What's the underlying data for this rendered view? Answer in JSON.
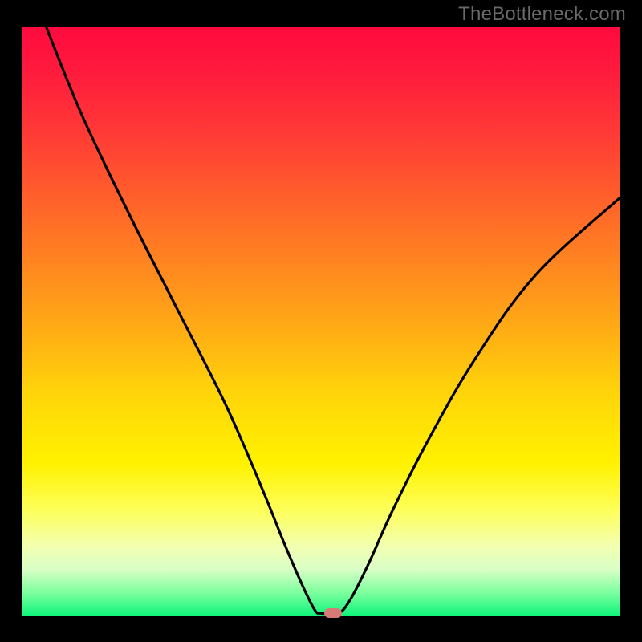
{
  "watermark": "TheBottleneck.com",
  "colors": {
    "page_bg": "#000000",
    "curve_stroke": "#000000",
    "marker_fill": "#d87b76",
    "watermark_text": "#6a6a6a",
    "gradient_top": "#ff0a3e",
    "gradient_mid": "#ffd40a",
    "gradient_bottom": "#0cf47a"
  },
  "chart_data": {
    "type": "line",
    "title": "",
    "xlabel": "",
    "ylabel": "",
    "xlim": [
      0,
      100
    ],
    "ylim": [
      0,
      100
    ],
    "grid": false,
    "legend": false,
    "curve_points": [
      {
        "x": 4,
        "y": 100
      },
      {
        "x": 10,
        "y": 85
      },
      {
        "x": 18,
        "y": 68
      },
      {
        "x": 26,
        "y": 52
      },
      {
        "x": 34,
        "y": 36
      },
      {
        "x": 40,
        "y": 22
      },
      {
        "x": 44,
        "y": 12
      },
      {
        "x": 47,
        "y": 5
      },
      {
        "x": 49,
        "y": 1
      },
      {
        "x": 50,
        "y": 0.5
      },
      {
        "x": 51,
        "y": 0.5
      },
      {
        "x": 53,
        "y": 0.5
      },
      {
        "x": 55,
        "y": 3
      },
      {
        "x": 58,
        "y": 9
      },
      {
        "x": 62,
        "y": 18
      },
      {
        "x": 68,
        "y": 30
      },
      {
        "x": 76,
        "y": 44
      },
      {
        "x": 86,
        "y": 58
      },
      {
        "x": 100,
        "y": 71
      }
    ],
    "marker": {
      "x": 52,
      "y": 0.5
    },
    "notes": "V-shaped black curve over vertical red→yellow→green gradient; small salmon pill marker at the valley bottom."
  }
}
